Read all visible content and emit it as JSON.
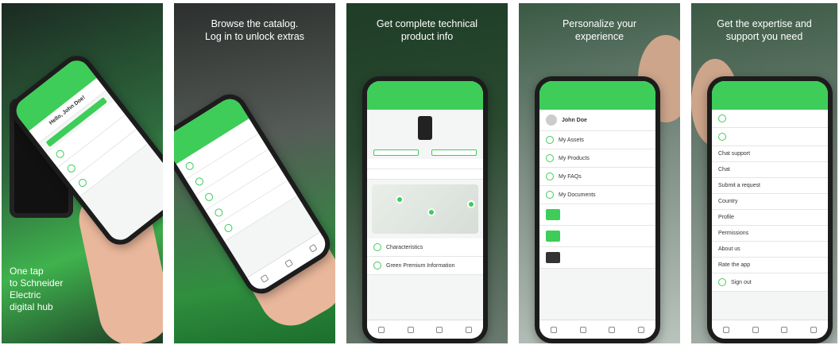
{
  "panels": [
    {
      "caption": "One tap\nto Schneider\nElectric\ndigital hub",
      "screen_greeting": "Hello, John Doe!",
      "screen_items": [
        "",
        "",
        "",
        ""
      ]
    },
    {
      "caption": "Browse the catalog.\nLog in to unlock extras"
    },
    {
      "caption": "Get complete technical\nproduct info",
      "screen_title": "Characteristics",
      "rows": [
        "Characteristics",
        "Green Premium Information"
      ]
    },
    {
      "caption": "Personalize your\nexperience",
      "profile_name": "John Doe",
      "rows": [
        "My Assets",
        "My Products",
        "My FAQs",
        "My Documents"
      ]
    },
    {
      "caption": "Get the expertise and\nsupport you need",
      "rows": [
        "Chat support",
        "Chat",
        "Submit a request",
        "Country",
        "Profile",
        "Permissions",
        "About us",
        "Rate the app",
        "Sign out"
      ]
    }
  ],
  "colors": {
    "brand_green": "#3dcd58"
  }
}
